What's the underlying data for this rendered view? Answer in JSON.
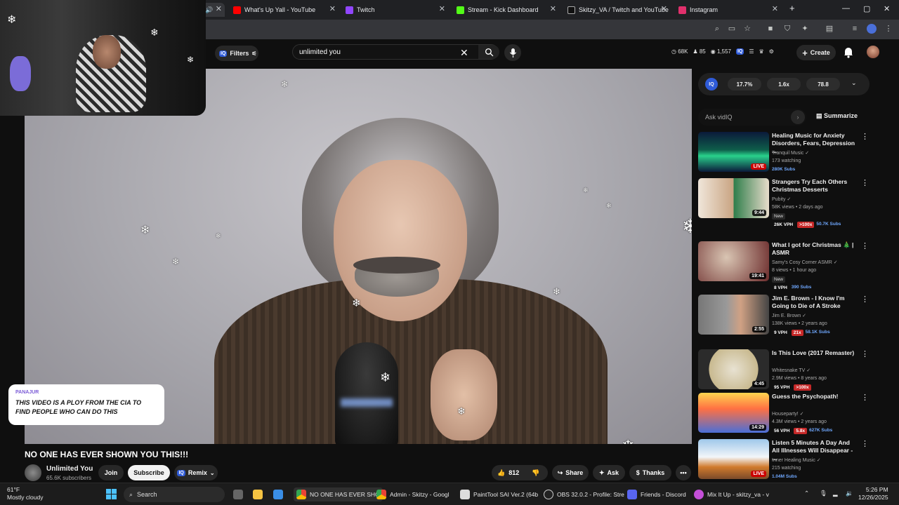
{
  "browser": {
    "tabs": [
      {
        "label": "What's Up Yall - YouTube",
        "color": "#ff0000"
      },
      {
        "label": "Twitch",
        "color": "#9146ff"
      },
      {
        "label": "Stream - Kick Dashboard",
        "color": "#53fc18"
      },
      {
        "label": "Skitzy_VA / Twitch and YouTube",
        "color": "#111111"
      },
      {
        "label": "Instagram",
        "color": "#e1306c"
      }
    ],
    "new_tab": "+",
    "win_min": "—",
    "win_max": "▢",
    "win_close": "✕"
  },
  "youtube": {
    "filters_label": "Filters",
    "search_value": "unlimited you",
    "stats": {
      "views": "68K",
      "likes": "85",
      "other": "1,557"
    },
    "create_label": "Create"
  },
  "video": {
    "title": "NO ONE HAS EVER SHOWN YOU THIS!!!",
    "channel_name": "Unlimited You",
    "channel_subs": "65.6K subscribers",
    "join_label": "Join",
    "subscribe_label": "Subscribe",
    "remix_label": "Remix",
    "like_count": "812",
    "share_label": "Share",
    "ask_label": "Ask",
    "thanks_label": "Thanks"
  },
  "chat": {
    "user": "PANAJUR",
    "message": "THIS VIDEO IS A PLOY FROM THE CIA TO FIND PEOPLE WHO CAN DO THIS"
  },
  "vidiq": {
    "logo": "IQ",
    "metrics": [
      "17.7%",
      "1.6x",
      "78.8"
    ],
    "ask_placeholder": "Ask vidIQ",
    "summarize_label": "Summarize"
  },
  "recommendations": [
    {
      "title": "Healing Music for Anxiety Disorders, Fears, Depression ...",
      "channel": "Tranquil Music",
      "meta": "173 watching",
      "duration": "LIVE",
      "badges": [
        "280K Subs"
      ],
      "thumb": "aurora"
    },
    {
      "title": "Strangers Try Each Others Christmas Desserts",
      "channel": "Pubity",
      "meta": "58K views • 2 days ago",
      "duration": "9:44",
      "new": "New",
      "badges": [
        "26K VPH",
        ">100x",
        "50.7K Subs"
      ],
      "thumb": "christmas"
    },
    {
      "title": "What I got for Christmas 🎄 | ASMR",
      "channel": "Samy's Cosy Corner ASMR",
      "meta": "8 views • 1 hour ago",
      "duration": "19:41",
      "new": "New",
      "badges": [
        "8 VPH",
        "390 Subs"
      ],
      "thumb": "asmr"
    },
    {
      "title": "Jim E. Brown - I Know I'm Going to Die of A Stroke",
      "channel": "Jim E. Brown",
      "meta": "138K views • 2 years ago",
      "duration": "2:55",
      "badges": [
        "9 VPH",
        "21x",
        "58.1K Subs"
      ],
      "thumb": "brown"
    },
    {
      "title": "Is This Love (2017 Remaster)",
      "channel": "Whitesnake TV",
      "meta": "2.9M views • 8 years ago",
      "duration": "4:45",
      "badges": [
        "95 VPH",
        ">100x"
      ],
      "thumb": "album"
    },
    {
      "title": "Guess the Psychopath!",
      "channel": "Houseparty!",
      "meta": "4.3M views • 2 years ago",
      "duration": "14:29",
      "badges": [
        "56 VPH",
        "5.8x",
        "627K Subs"
      ],
      "thumb": "psycho"
    },
    {
      "title": "Listen 5 Minutes A Day And All Illnesses Will Disappear - ...",
      "channel": "Inner Healing Music",
      "meta": "215 watching",
      "duration": "LIVE",
      "badges": [
        "1.04M Subs"
      ],
      "thumb": "monk"
    }
  ],
  "taskbar": {
    "weather_temp": "61°F",
    "weather_desc": "Mostly cloudy",
    "search_label": "Search",
    "apps": [
      "NO ONE HAS EVER SHO",
      "Admin - Skitzy - Googl",
      "PaintTool SAI Ver.2 (64b",
      "OBS 32.0.2 - Profile: Stre",
      "Friends - Discord",
      "Mix It Up - skitzy_va - v"
    ],
    "time": "5:26 PM",
    "date": "12/26/2025"
  }
}
